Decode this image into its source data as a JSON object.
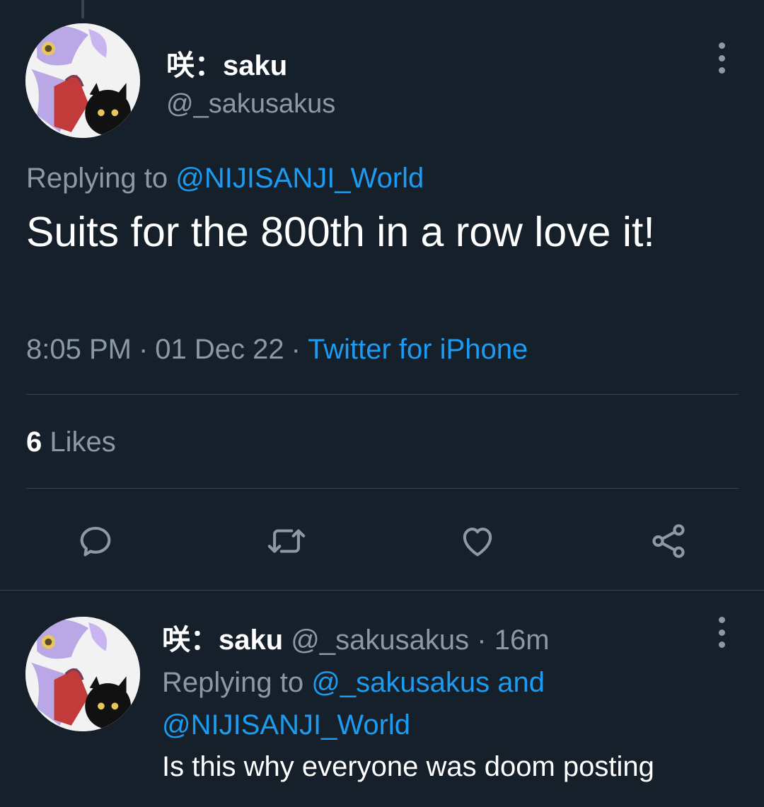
{
  "tweet": {
    "display_name": "咲：saku",
    "handle": "@_sakusakus",
    "replying_prefix": "Replying to",
    "replying_handle": "@NIJISANJI_World",
    "text": "Suits for the 800th in a row love it!",
    "time": "8:05 PM",
    "date": "01 Dec 22",
    "source": "Twitter for iPhone",
    "likes_count": "6",
    "likes_label": "Likes"
  },
  "actions": {
    "reply_icon": "reply-icon",
    "retweet_icon": "retweet-icon",
    "like_icon": "heart-icon",
    "share_icon": "share-icon"
  },
  "reply": {
    "display_name": "咲：saku",
    "handle": "@_sakusakus",
    "time_ago": "16m",
    "replying_prefix": "Replying to",
    "replying_handle_1": "@_sakusakus",
    "replying_and": "and",
    "replying_handle_2": "@NIJISANJI_World",
    "text": "Is this why everyone was doom posting"
  },
  "colors": {
    "background": "#15202b",
    "text_primary": "#ffffff",
    "text_secondary": "#8b98a5",
    "link": "#1d9bf0",
    "divider": "#38444d"
  }
}
